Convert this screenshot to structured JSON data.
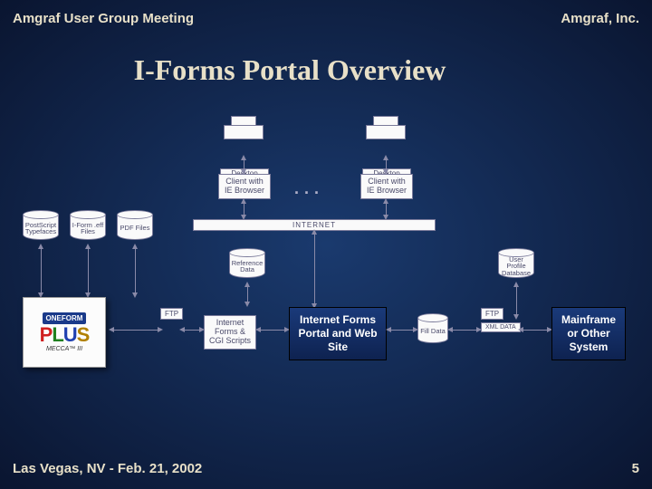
{
  "header": {
    "left": "Amgraf User Group Meeting",
    "right": "Amgraf, Inc."
  },
  "title": "I-Forms Portal Overview",
  "footer": {
    "left": "Las Vegas, NV - Feb. 21, 2002",
    "page": "5"
  },
  "diagram": {
    "printers": [
      "Desktop Printer",
      "Desktop Printer"
    ],
    "clients": [
      "Client with IE Browser",
      "Client with IE Browser"
    ],
    "ellipsis": "...",
    "internet_label": "INTERNET",
    "cylinders_left": [
      "PostScript Typefaces",
      "I-Form .eff Files",
      "PDF Files"
    ],
    "cyl_reference": "Reference Data",
    "cyl_userprofile": "User Profile Database",
    "internet_forms_box": "Internet Forms & CGI Scripts",
    "fill_data": "Fill Data",
    "xml_data": "XML DATA",
    "ftp_left": "FTP",
    "ftp_right": "FTP",
    "portal_box": "Internet Forms Portal and Web Site",
    "mainframe_box": "Mainframe or Other System",
    "logo": {
      "brand": "ONEFORM",
      "plus": "PLUS",
      "sub": "MECCA™ III"
    }
  }
}
